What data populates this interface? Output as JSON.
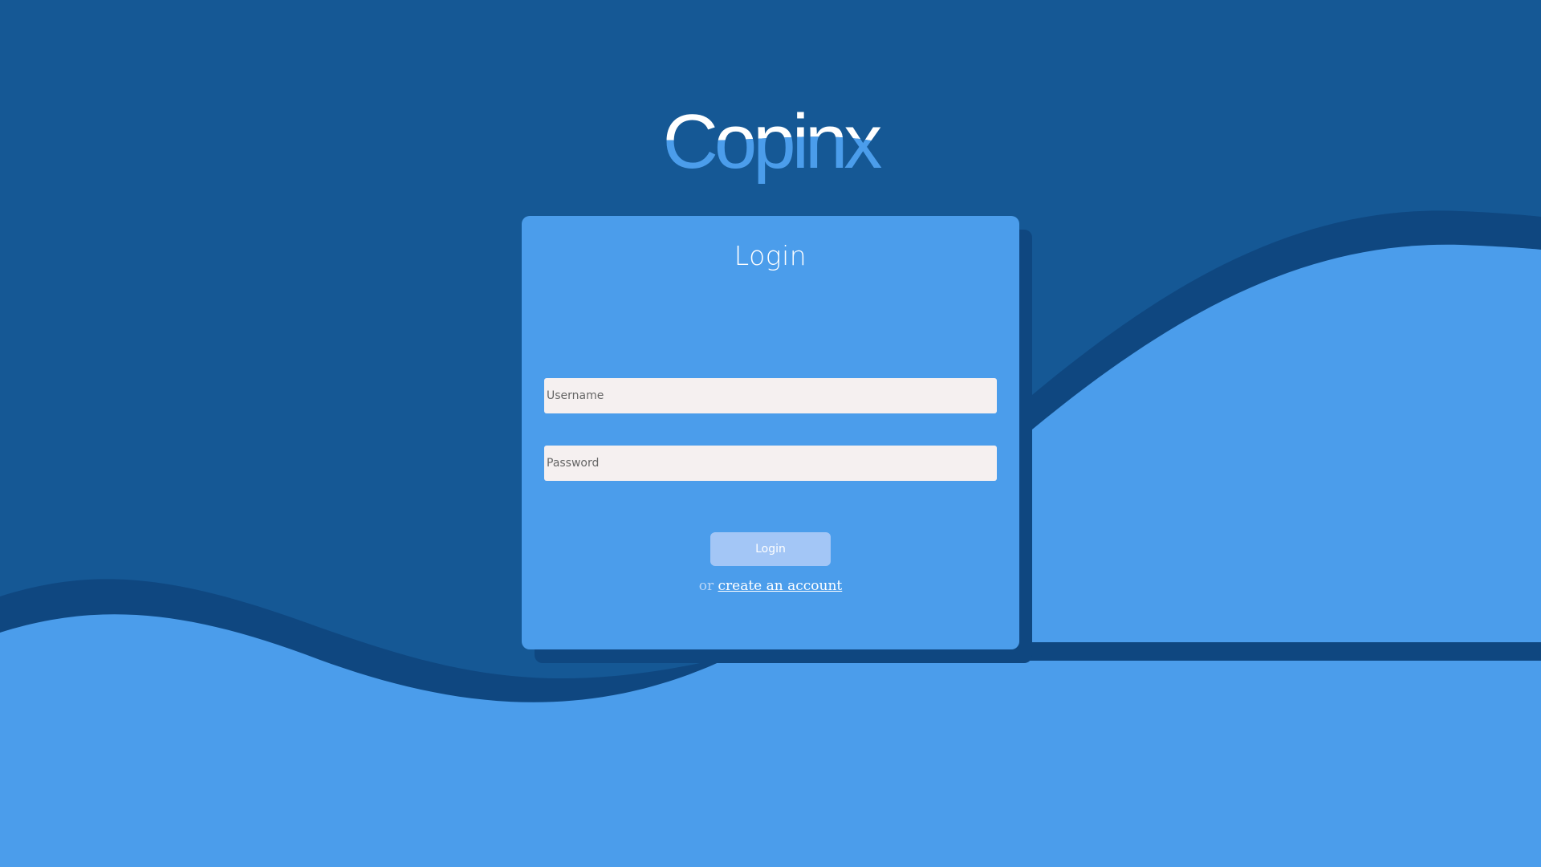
{
  "brand": {
    "logo_text": "Copinx"
  },
  "colors": {
    "background_dark": "#155895",
    "wave_shadow": "#0f4780",
    "wave_light": "#4b9deb",
    "card": "#4b9deb",
    "input_background": "#f5f0f0",
    "button_disabled": "#a3c6f6"
  },
  "login_form": {
    "title": "Login",
    "username": {
      "value": "",
      "placeholder": "Username"
    },
    "password": {
      "value": "",
      "placeholder": "Password"
    },
    "submit_label": "Login",
    "signup_prefix": "or",
    "signup_link": "create an account"
  }
}
